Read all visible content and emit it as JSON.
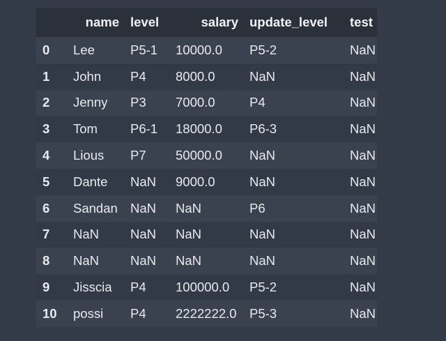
{
  "dataframe": {
    "columns": [
      "name",
      "level",
      "salary",
      "update_level",
      "test"
    ],
    "rows": [
      {
        "index": "0",
        "cells": [
          "Lee",
          "P5-1",
          "10000.0",
          "P5-2",
          "NaN"
        ]
      },
      {
        "index": "1",
        "cells": [
          "John",
          "P4",
          "8000.0",
          "NaN",
          "NaN"
        ]
      },
      {
        "index": "2",
        "cells": [
          "Jenny",
          "P3",
          "7000.0",
          "P4",
          "NaN"
        ]
      },
      {
        "index": "3",
        "cells": [
          "Tom",
          "P6-1",
          "18000.0",
          "P6-3",
          "NaN"
        ]
      },
      {
        "index": "4",
        "cells": [
          "Lious",
          "P7",
          "50000.0",
          "NaN",
          "NaN"
        ]
      },
      {
        "index": "5",
        "cells": [
          "Dante",
          "NaN",
          "9000.0",
          "NaN",
          "NaN"
        ]
      },
      {
        "index": "6",
        "cells": [
          "Sandan",
          "NaN",
          "NaN",
          "P6",
          "NaN"
        ]
      },
      {
        "index": "7",
        "cells": [
          "NaN",
          "NaN",
          "NaN",
          "NaN",
          "NaN"
        ]
      },
      {
        "index": "8",
        "cells": [
          "NaN",
          "NaN",
          "NaN",
          "NaN",
          "NaN"
        ]
      },
      {
        "index": "9",
        "cells": [
          "Jisscia",
          "P4",
          "100000.0",
          "P5-2",
          "NaN"
        ]
      },
      {
        "index": "10",
        "cells": [
          "possi",
          "P4",
          "2222222.0",
          "P5-3",
          "NaN"
        ]
      }
    ]
  }
}
